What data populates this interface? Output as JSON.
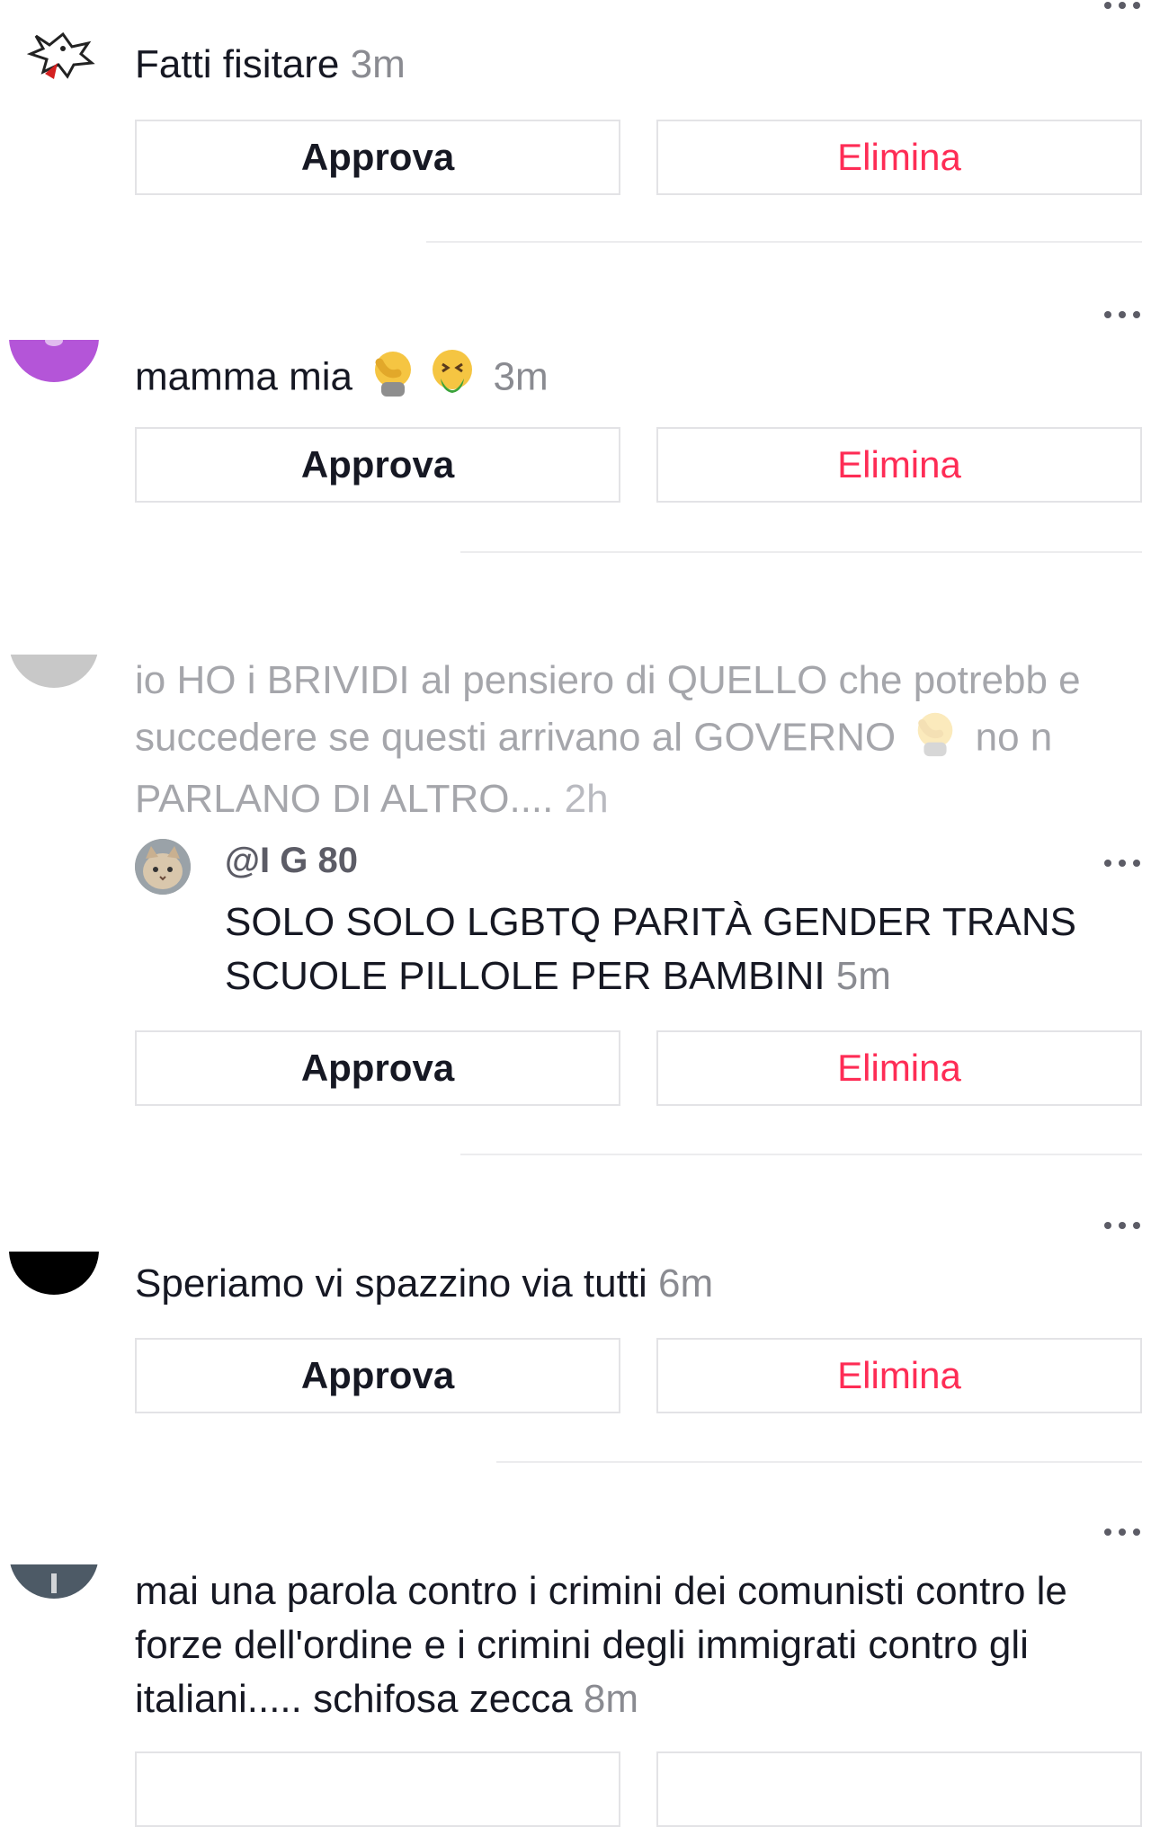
{
  "comments": [
    {
      "text": "Fatti fisitare",
      "time": "3m"
    },
    {
      "text": "mamma mia",
      "emojis": [
        "facepalm-emoji",
        "vomiting-face-emoji"
      ],
      "time": "3m"
    },
    {
      "text_before_emoji": "io HO i BRIVIDI al pensiero di QUELLO che potrebb e succedere se questi arrivano al GOVERNO",
      "text_after_emoji": "no n PARLANO DI ALTRO....",
      "emoji": "facepalm-emoji",
      "time": "2h",
      "reply": {
        "handle": "@I G 80",
        "text": "SOLO SOLO LGBTQ PARITÀ GENDER TRANS SCUOLE PILLOLE PER BAMBINI",
        "time": "5m"
      }
    },
    {
      "text": "Speriamo vi spazzino via tutti",
      "time": "6m"
    },
    {
      "text": "mai una parola contro i crimini dei comunisti contro le forze dell'ordine e i crimini degli immigrati contro gli italiani..... schifosa zecca",
      "time": "8m"
    }
  ],
  "actions": {
    "approve_label": "Approva",
    "delete_label": "Elimina"
  },
  "colors": {
    "delete": "#fe2c55",
    "muted": "#a5a6ab",
    "avatar_purple": "#b455d8",
    "avatar_dark": "#000000",
    "avatar_slate": "#4d5a66"
  }
}
